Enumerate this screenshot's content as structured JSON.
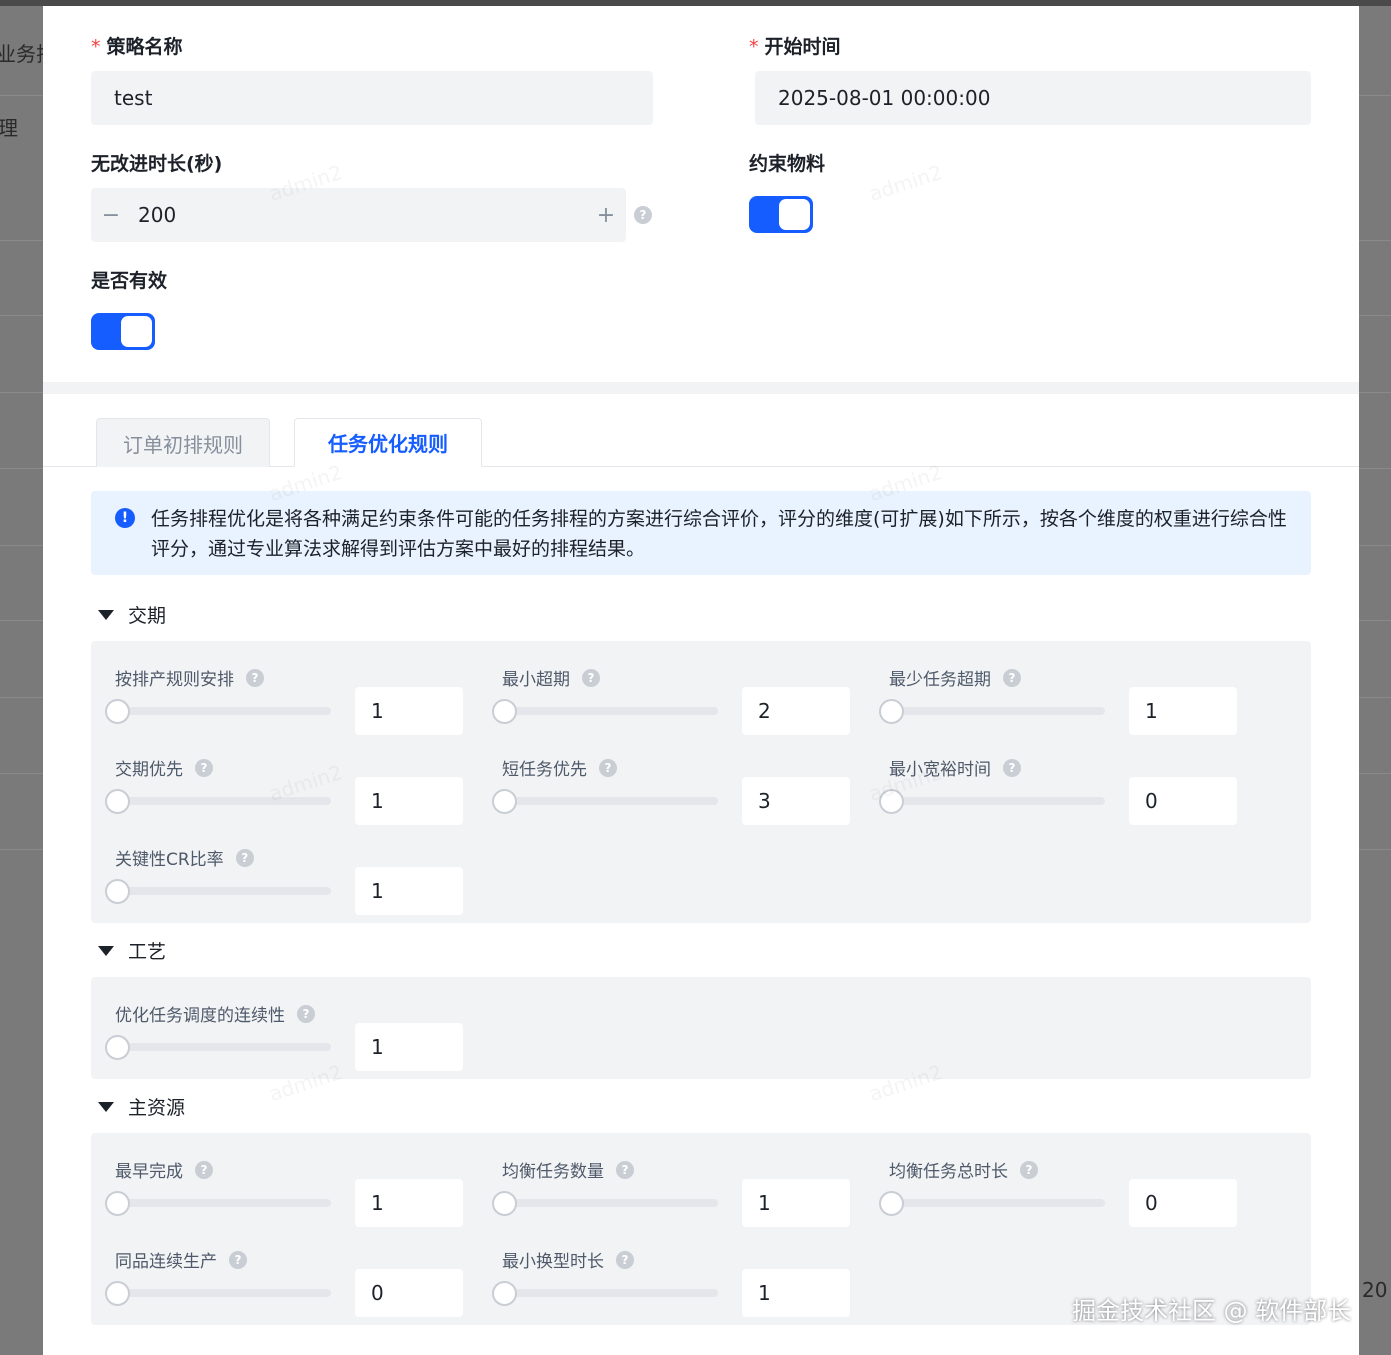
{
  "background": {
    "left_text_1": "业务排",
    "left_text_2": "理",
    "right_text": "20"
  },
  "form": {
    "strategy_name": {
      "required_mark": "*",
      "label": "策略名称",
      "value": "test"
    },
    "start_time": {
      "required_mark": "*",
      "label": "开始时间",
      "value": "2025-08-01 00:00:00"
    },
    "no_improve_duration": {
      "label": "无改进时长(秒)",
      "value": "200",
      "minus": "−",
      "plus": "+",
      "help": "?"
    },
    "constraint_material": {
      "label": "约束物料",
      "on": true
    },
    "is_valid": {
      "label": "是否有效",
      "on": true
    }
  },
  "tabs": [
    {
      "label": "订单初排规则",
      "active": false
    },
    {
      "label": "任务优化规则",
      "active": true
    }
  ],
  "alert": {
    "icon": "!",
    "text": "任务排程优化是将各种满足约束条件可能的任务排程的方案进行综合评价，评分的维度(可扩展)如下所示，按各个维度的权重进行综合性评分，通过专业算法求解得到评估方案中最好的排程结果。"
  },
  "groups": {
    "delivery": {
      "title": "交期",
      "items": [
        {
          "label": "按排产规则安排",
          "value": "1"
        },
        {
          "label": "最小超期",
          "value": "2"
        },
        {
          "label": "最少任务超期",
          "value": "1"
        },
        {
          "label": "交期优先",
          "value": "1"
        },
        {
          "label": "短任务优先",
          "value": "3"
        },
        {
          "label": "最小宽裕时间",
          "value": "0"
        },
        {
          "label": "关键性CR比率",
          "value": "1"
        }
      ]
    },
    "process": {
      "title": "工艺",
      "items": [
        {
          "label": "优化任务调度的连续性",
          "value": "1"
        }
      ]
    },
    "main_resource": {
      "title": "主资源",
      "items": [
        {
          "label": "最早完成",
          "value": "1"
        },
        {
          "label": "均衡任务数量",
          "value": "1"
        },
        {
          "label": "均衡任务总时长",
          "value": "0"
        },
        {
          "label": "同品连续生产",
          "value": "0"
        },
        {
          "label": "最小换型时长",
          "value": "1"
        }
      ]
    }
  },
  "help_glyph": "?",
  "watermark_text": "admin2",
  "credit": "掘金技术社区 @ 软件部长",
  "colors": {
    "primary": "#165dff",
    "required": "#f53f3f",
    "panel": "#f2f3f5"
  }
}
